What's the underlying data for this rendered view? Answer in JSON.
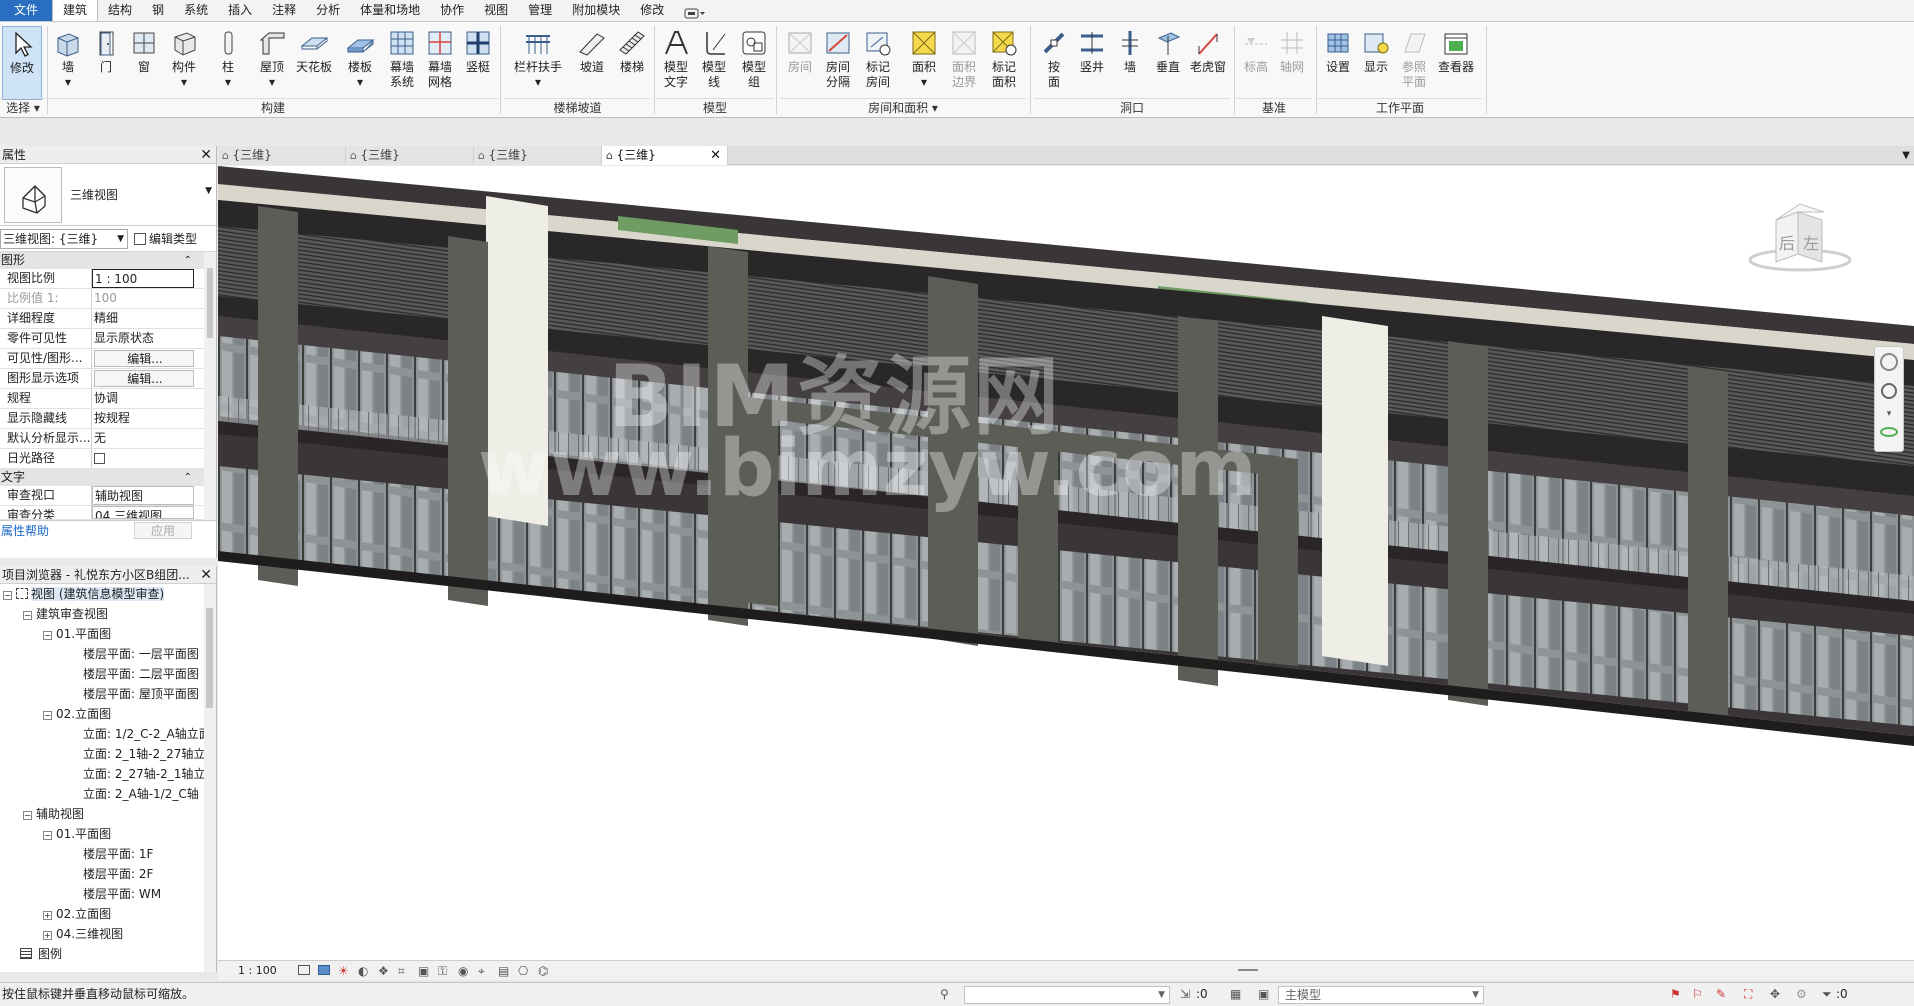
{
  "ribbon": {
    "tabs": [
      "文件",
      "建筑",
      "结构",
      "钢",
      "系统",
      "插入",
      "注释",
      "分析",
      "体量和场地",
      "协作",
      "视图",
      "管理",
      "附加模块",
      "修改"
    ],
    "active_tab": "建筑",
    "tools": {
      "modify": "修改",
      "wall": "墙",
      "door": "门",
      "window": "窗",
      "component": "构件",
      "column": "柱",
      "roof": "屋顶",
      "ceiling": "天花板",
      "floor": "楼板",
      "curtain_system": [
        "幕墙",
        "系统"
      ],
      "curtain_grid": [
        "幕墙",
        "网格"
      ],
      "mullion": "竖梃",
      "railing": "栏杆扶手",
      "ramp": "坡道",
      "stair": "楼梯",
      "model_text": [
        "模型",
        "文字"
      ],
      "model_line": [
        "模型",
        "线"
      ],
      "model_group": [
        "模型",
        "组"
      ],
      "room": "房间",
      "room_separator": [
        "房间",
        "分隔"
      ],
      "tag_room": [
        "标记",
        "房间"
      ],
      "area": "面积",
      "area_boundary": [
        "面积",
        "边界"
      ],
      "tag_area": [
        "标记",
        "面积"
      ],
      "by_face": [
        "按",
        "面"
      ],
      "shaft": "竖井",
      "opening_wall": "墙",
      "vertical": "垂直",
      "dormer": "老虎窗",
      "level": "标高",
      "grid": "轴网",
      "set": "设置",
      "show": "显示",
      "ref_plane": [
        "参照",
        "平面"
      ],
      "viewer": "查看器"
    },
    "groups": {
      "select": "选择 ▾",
      "build": "构建",
      "circulation": "楼梯坡道",
      "model": "模型",
      "room_area": "房间和面积 ▾",
      "opening": "洞口",
      "datum": "基准",
      "work_plane": "工作平面"
    }
  },
  "properties": {
    "title": "属性",
    "type_name": "三维视图",
    "instance_selector": "三维视图: {三维}",
    "edit_type": "编辑类型",
    "sections": {
      "graphics": "图形",
      "text": "文字"
    },
    "rows": [
      {
        "key": "视图比例",
        "value": "1 : 100"
      },
      {
        "key": "比例值 1:",
        "value": "100"
      },
      {
        "key": "详细程度",
        "value": "精细"
      },
      {
        "key": "零件可见性",
        "value": "显示原状态"
      },
      {
        "key": "可见性/图形...",
        "value": "编辑..."
      },
      {
        "key": "图形显示选项",
        "value": "编辑..."
      },
      {
        "key": "规程",
        "value": "协调"
      },
      {
        "key": "显示隐藏线",
        "value": "按规程"
      },
      {
        "key": "默认分析显示...",
        "value": "无"
      },
      {
        "key": "日光路径",
        "value": ""
      }
    ],
    "text_rows": [
      {
        "key": "审查视口",
        "value": "辅助视图"
      },
      {
        "key": "审查分类",
        "value": "04.三维视图"
      }
    ],
    "help_link": "属性帮助",
    "apply": "应用"
  },
  "browser": {
    "title": "项目浏览器 - 礼悦东方小区B组团...",
    "items": [
      "视图 (建筑信息模型审查)",
      "建筑审查视图",
      "01.平面图",
      "楼层平面: 一层平面图",
      "楼层平面: 二层平面图",
      "楼层平面: 屋顶平面图",
      "02.立面图",
      "立面: 1/2_C-2_A轴立面",
      "立面: 2_1轴-2_27轴立",
      "立面: 2_27轴-2_1轴立",
      "立面: 2_A轴-1/2_C轴",
      "辅助视图",
      "01.平面图",
      "楼层平面: 1F",
      "楼层平面: 2F",
      "楼层平面: WM",
      "02.立面图",
      "04.三维视图",
      "图例"
    ]
  },
  "view_tabs": [
    "{三维}",
    "{三维}",
    "{三维}",
    "{三维}"
  ],
  "viewcube": {
    "left_face": "后",
    "right_face": "左"
  },
  "watermark": {
    "line1": "BIM资源网",
    "line2": "www.bimzyw.com"
  },
  "view_bar": {
    "scale": "1 : 100"
  },
  "status": {
    "hint": "按住鼠标键并垂直移动鼠标可缩放。",
    "selection_count": ":0",
    "model": "主模型",
    "filter_count": ":0"
  }
}
